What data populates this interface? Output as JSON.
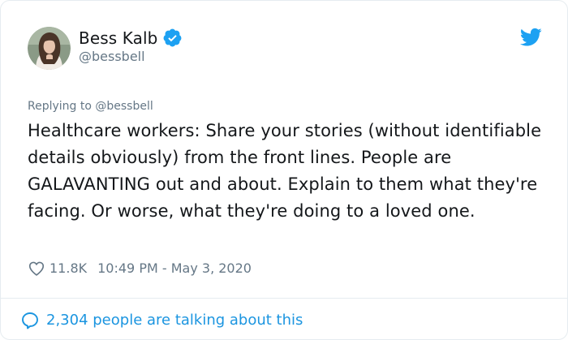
{
  "author": {
    "display_name": "Bess Kalb",
    "handle": "@bessbell",
    "verified": true,
    "avatar_icon": "avatar-photo"
  },
  "reply": {
    "prefix": "Replying to",
    "to_handle": "@bessbell"
  },
  "tweet": {
    "text": "Healthcare workers: Share your stories (without identifiable details obviously) from the front lines. People are GALAVANTING out and about. Explain to them what they're facing. Or worse, what they're doing to a loved one."
  },
  "meta": {
    "likes": "11.8K",
    "timestamp": "10:49 PM - May 3, 2020"
  },
  "footer": {
    "talking_text": "2,304 people are talking about this"
  },
  "icons": {
    "verified": "verified-badge-icon",
    "twitter": "twitter-bird-icon",
    "heart": "heart-outline-icon",
    "bubble": "speech-bubble-icon"
  },
  "colors": {
    "twitter_blue": "#1da1f2",
    "link_blue": "#1b95e0",
    "text_primary": "#14171a",
    "text_secondary": "#657786",
    "border": "#e6ecf0"
  }
}
